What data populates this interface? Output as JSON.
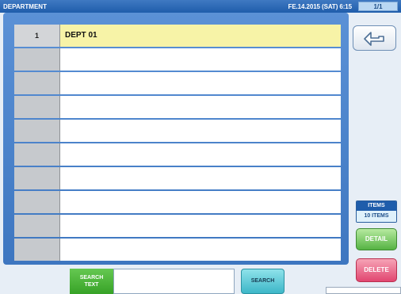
{
  "header": {
    "title": "DEPARTMENT",
    "datetime": "FE.14.2015 (SAT)  6:15",
    "page": "1/1"
  },
  "rows": [
    {
      "num": "1",
      "name": "DEPT 01",
      "selected": true
    },
    {
      "num": "",
      "name": ""
    },
    {
      "num": "",
      "name": ""
    },
    {
      "num": "",
      "name": ""
    },
    {
      "num": "",
      "name": ""
    },
    {
      "num": "",
      "name": ""
    },
    {
      "num": "",
      "name": ""
    },
    {
      "num": "",
      "name": ""
    },
    {
      "num": "",
      "name": ""
    },
    {
      "num": "",
      "name": ""
    }
  ],
  "side": {
    "back_icon": "return-arrow-icon",
    "items_label": "ITEMS",
    "items_value": "10 ITEMS",
    "detail_label": "DETAIL",
    "delete_label": "DELETE"
  },
  "search": {
    "label_line1": "SEARCH",
    "label_line2": "TEXT",
    "value": "",
    "button_label": "SEARCH"
  },
  "colors": {
    "header_bg": "#1f5dab",
    "panel_bg": "#4a83cc",
    "selected_row": "#f7f3a7",
    "detail_green": "#55b343",
    "delete_pink": "#e14670",
    "search_teal": "#3db7c8"
  }
}
